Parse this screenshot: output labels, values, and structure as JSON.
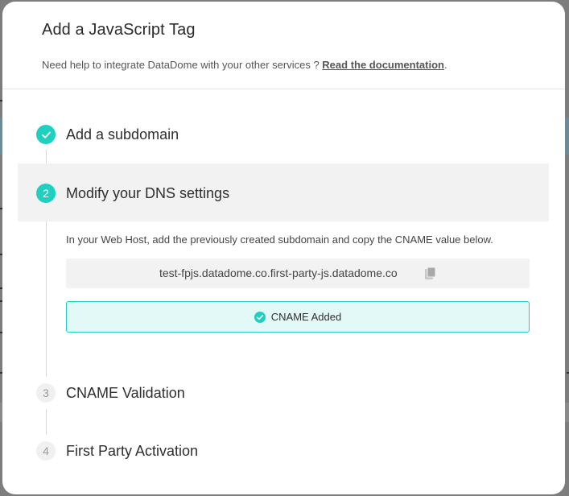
{
  "modal": {
    "title": "Add a JavaScript Tag",
    "subtitle_text": "Need help to integrate DataDome with your other services ? ",
    "subtitle_link": "Read the documentation",
    "subtitle_end": "."
  },
  "steps": [
    {
      "number": "1",
      "label": "Add a subdomain",
      "state": "done",
      "icon": "check-icon"
    },
    {
      "number": "2",
      "label": "Modify your DNS settings",
      "state": "current"
    },
    {
      "number": "3",
      "label": "CNAME Validation",
      "state": "pending"
    },
    {
      "number": "4",
      "label": "First Party Activation",
      "state": "pending"
    }
  ],
  "dns": {
    "instructions": "In your Web Host, add the previously created subdomain and copy the CNAME value below.",
    "cname_value": "test-fpjs.datadome.co.first-party-js.datadome.co",
    "copy_icon": "copy-icon",
    "added_label": "CNAME Added",
    "added_icon": "check-circle-icon"
  },
  "colors": {
    "accent": "#1fd0c1",
    "accent_bg": "#e3f9f7",
    "active_row": "#f2f2f2",
    "overlay": "#7d7d7d"
  }
}
